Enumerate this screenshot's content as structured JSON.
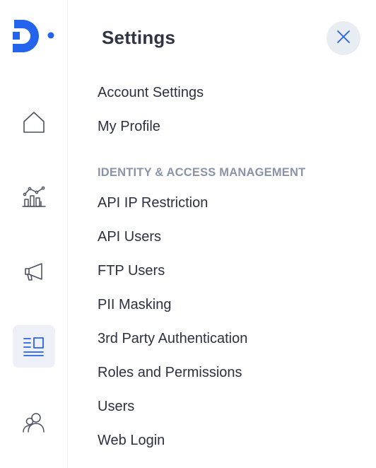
{
  "brand": {
    "accent_color": "#2463eb",
    "logo_icon": "brand-logo-d-icon"
  },
  "rail": {
    "items": [
      {
        "icon": "home-icon",
        "active": false
      },
      {
        "icon": "analytics-chart-icon",
        "active": false
      },
      {
        "icon": "megaphone-icon",
        "active": false
      },
      {
        "icon": "document-list-icon",
        "active": true
      },
      {
        "icon": "users-group-icon",
        "active": false
      }
    ]
  },
  "settings": {
    "title": "Settings",
    "close_icon": "close-icon",
    "items": [
      {
        "label": "Account Settings"
      },
      {
        "label": "My Profile"
      }
    ],
    "iam_section": {
      "heading": "IDENTITY & ACCESS MANAGEMENT",
      "items": [
        {
          "label": "API IP Restriction"
        },
        {
          "label": "API Users"
        },
        {
          "label": "FTP Users"
        },
        {
          "label": "PII Masking"
        },
        {
          "label": "3rd Party Authentication"
        },
        {
          "label": "Roles and Permissions"
        },
        {
          "label": "Users"
        },
        {
          "label": "Web Login"
        }
      ]
    }
  }
}
